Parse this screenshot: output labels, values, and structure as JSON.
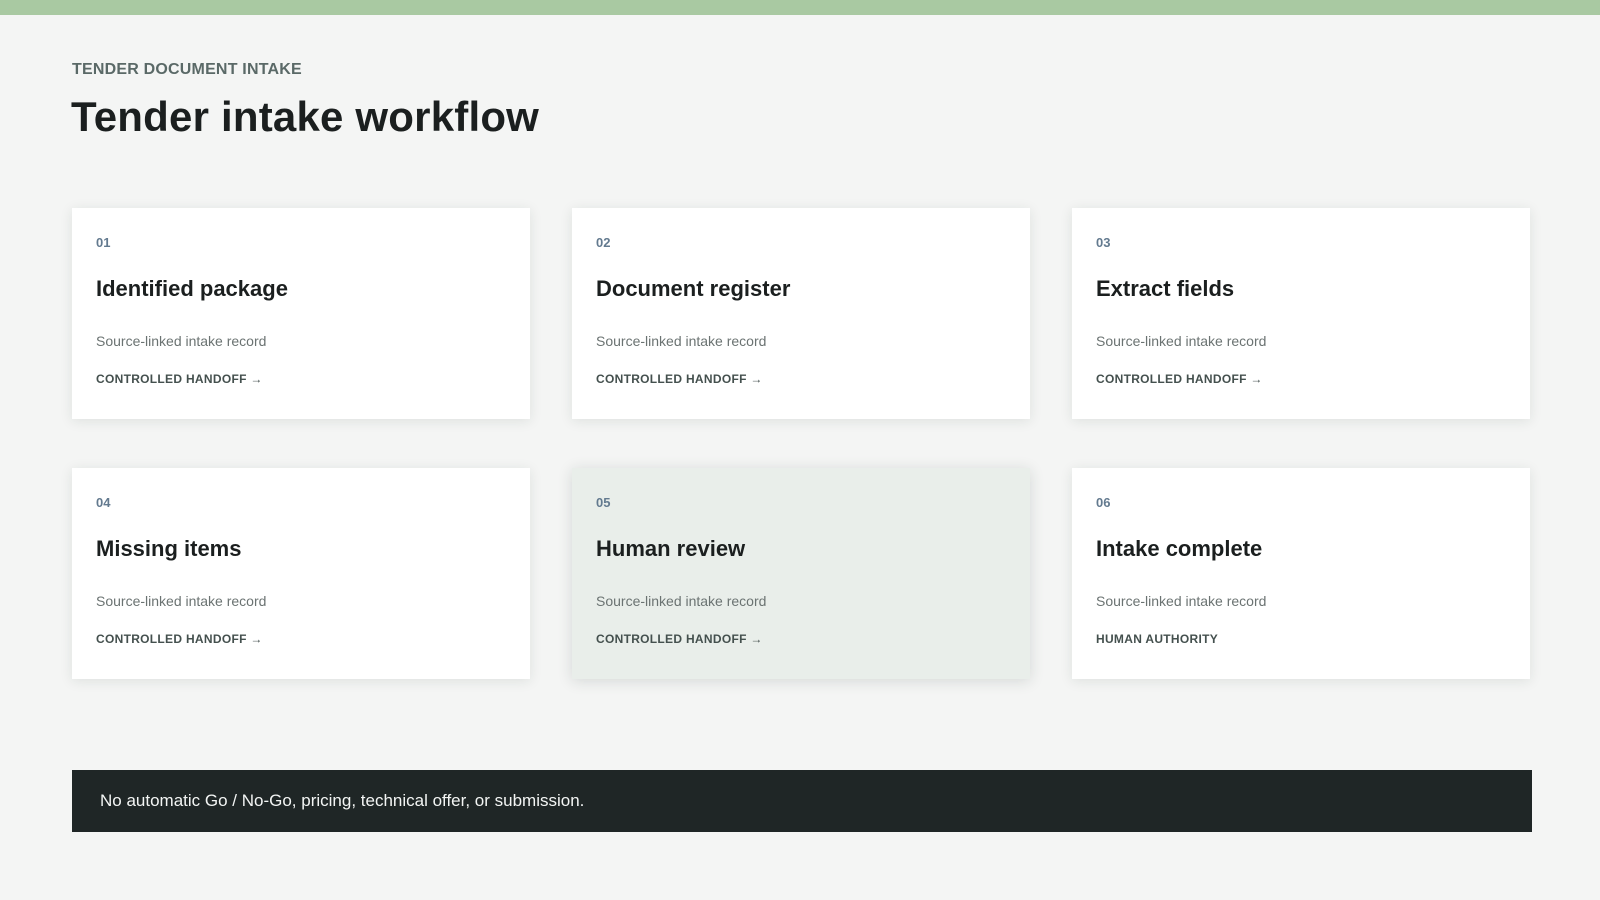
{
  "header": {
    "eyebrow": "TENDER DOCUMENT INTAKE",
    "title": "Tender intake workflow"
  },
  "steps": [
    {
      "number": "01",
      "title": "Identified package",
      "description": "Source-linked intake record",
      "handoff": "CONTROLLED HANDOFF →"
    },
    {
      "number": "02",
      "title": "Document register",
      "description": "Source-linked intake record",
      "handoff": "CONTROLLED HANDOFF →"
    },
    {
      "number": "03",
      "title": "Extract fields",
      "description": "Source-linked intake record",
      "handoff": "CONTROLLED HANDOFF →"
    },
    {
      "number": "04",
      "title": "Missing items",
      "description": "Source-linked intake record",
      "handoff": "CONTROLLED HANDOFF →"
    },
    {
      "number": "05",
      "title": "Human review",
      "description": "Source-linked intake record",
      "handoff": "CONTROLLED HANDOFF →"
    },
    {
      "number": "06",
      "title": "Intake complete",
      "description": "Source-linked intake record",
      "handoff": "HUMAN AUTHORITY"
    }
  ],
  "footer": {
    "note": "No automatic Go / No-Go, pricing, technical offer, or submission."
  },
  "colors": {
    "accent_bar": "#a9c9a2",
    "background": "#f4f5f4",
    "card": "#ffffff",
    "highlighted_card": "#e9eeea",
    "footer": "#1f2626",
    "step_number": "#637a8f"
  }
}
